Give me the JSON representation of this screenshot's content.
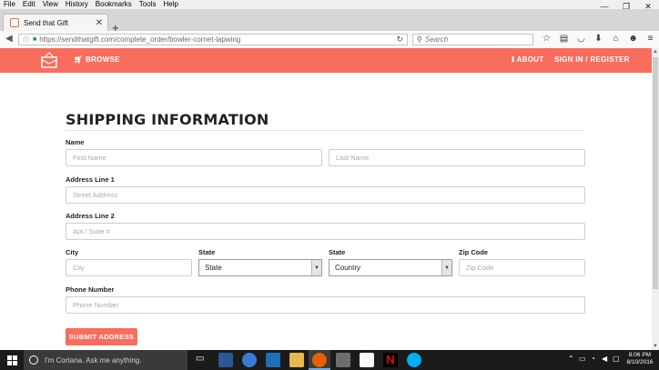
{
  "browser": {
    "menu": [
      "File",
      "Edit",
      "View",
      "History",
      "Bookmarks",
      "Tools",
      "Help"
    ],
    "tab_title": "Send that Gift",
    "tab_close": "✕",
    "new_tab": "+",
    "window_controls": {
      "minimize": "—",
      "restore": "❐",
      "close": "✕"
    },
    "url": "https://sendthatgift.com/complete_order/bowler-cornet-lapwing",
    "search_placeholder": "Search"
  },
  "site_nav": {
    "browse_label": "BROWSE",
    "about_label": "ABOUT",
    "signin_label": "SIGN IN / REGISTER"
  },
  "form": {
    "heading": "SHIPPING INFORMATION",
    "name_label": "Name",
    "first_name_placeholder": "First Name",
    "last_name_placeholder": "Last Name",
    "address1_label": "Address Line 1",
    "address1_placeholder": "Street Address",
    "address2_label": "Address Line 2",
    "address2_placeholder": "Apt / Suite #",
    "city_label": "City",
    "city_placeholder": "City",
    "state_label": "State",
    "state_value": "State",
    "country_label": "State",
    "country_value": "Country",
    "zip_label": "Zip Code",
    "zip_placeholder": "Zip Code",
    "phone_label": "Phone Number",
    "phone_placeholder": "Phone Number",
    "submit_label": "SUBMIT ADDRESS"
  },
  "taskbar": {
    "cortana_text": "I'm Cortana. Ask me anything.",
    "time": "8:06 PM",
    "date": "8/10/2016"
  },
  "colors": {
    "accent": "#f96d5d",
    "taskbar": "#1b1b1b"
  }
}
